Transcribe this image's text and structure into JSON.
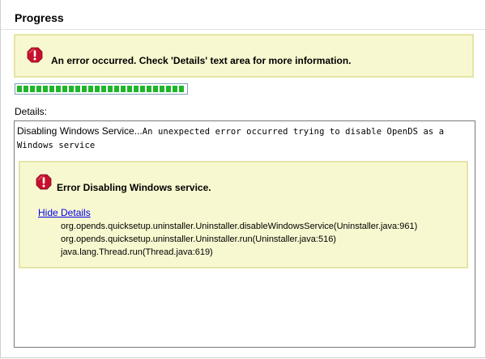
{
  "progress": {
    "title": "Progress",
    "error_banner": {
      "icon": "error-icon",
      "message": "An error occurred. Check 'Details' text area for more information."
    },
    "bar": {
      "fraction_complete": 1.0,
      "color": "#1fb62a"
    },
    "details": {
      "label": "Details:",
      "prefix": "Disabling Windows Service...",
      "text": "An unexpected error occurred trying to disable OpenDS as a Windows service",
      "error_box": {
        "icon": "error-icon",
        "title": "Error Disabling Windows service.",
        "link_label": "Hide Details",
        "stack_trace": [
          "org.opends.quicksetup.uninstaller.Uninstaller.disableWindowsService(Uninstaller.java:961)",
          "org.opends.quicksetup.uninstaller.Uninstaller.run(Uninstaller.java:516)",
          "java.lang.Thread.run(Thread.java:619)"
        ]
      }
    }
  },
  "colors": {
    "alert_background": "#f8f8d0",
    "alert_border": "#e4e4a6",
    "error_icon": "#c8102e",
    "link": "#0000ee"
  }
}
